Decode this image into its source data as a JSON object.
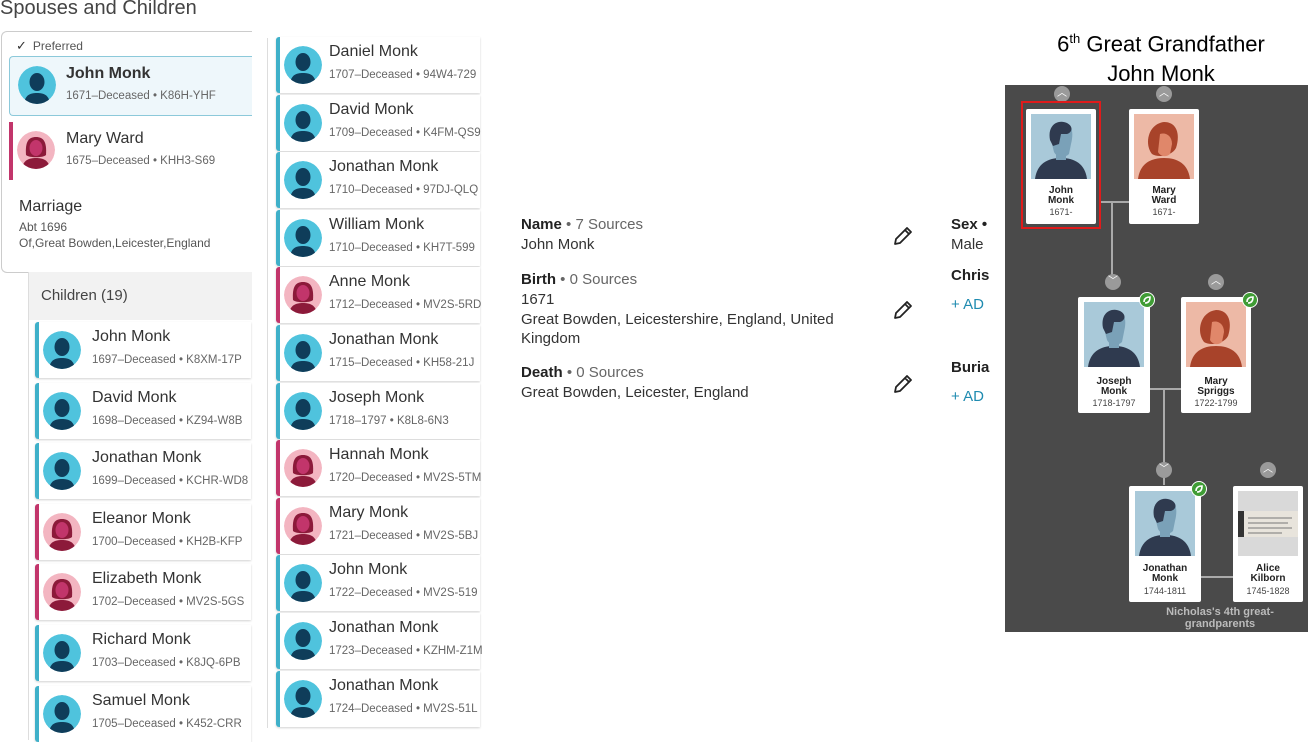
{
  "spouses": {
    "title": "Spouses and Children",
    "preferred_label": "Preferred",
    "husband": {
      "name": "John Monk",
      "meta": "1671–Deceased • K86H-YHF"
    },
    "wife": {
      "name": "Mary Ward",
      "meta": "1675–Deceased • KHH3-S69"
    },
    "marriage": {
      "title": "Marriage",
      "date": "Abt 1696",
      "place": "Of,Great Bowden,Leicester,England"
    }
  },
  "children_header": "Children (19)",
  "children_col1": [
    {
      "name": "John Monk",
      "meta": "1697–Deceased • K8XM-17P",
      "gender": "male"
    },
    {
      "name": "David Monk",
      "meta": "1698–Deceased • KZ94-W8B",
      "gender": "male"
    },
    {
      "name": "Jonathan Monk",
      "meta": "1699–Deceased • KCHR-WD8",
      "gender": "male"
    },
    {
      "name": "Eleanor Monk",
      "meta": "1700–Deceased • KH2B-KFP",
      "gender": "female"
    },
    {
      "name": "Elizabeth Monk",
      "meta": "1702–Deceased • MV2S-5GS",
      "gender": "female"
    },
    {
      "name": "Richard Monk",
      "meta": "1703–Deceased • K8JQ-6PB",
      "gender": "male"
    },
    {
      "name": "Samuel Monk",
      "meta": "1705–Deceased • K452-CRR",
      "gender": "male"
    }
  ],
  "children_col2": [
    {
      "name": "Daniel Monk",
      "meta": "1707–Deceased • 94W4-729",
      "gender": "male"
    },
    {
      "name": "David Monk",
      "meta": "1709–Deceased • K4FM-QS9",
      "gender": "male"
    },
    {
      "name": "Jonathan Monk",
      "meta": "1710–Deceased • 97DJ-QLQ",
      "gender": "male"
    },
    {
      "name": "William Monk",
      "meta": "1710–Deceased • KH7T-599",
      "gender": "male"
    },
    {
      "name": "Anne Monk",
      "meta": "1712–Deceased • MV2S-5RD",
      "gender": "female"
    },
    {
      "name": "Jonathan Monk",
      "meta": "1715–Deceased • KH58-21J",
      "gender": "male"
    },
    {
      "name": "Joseph Monk",
      "meta": "1718–1797 • K8L8-6N3",
      "gender": "male"
    },
    {
      "name": "Hannah Monk",
      "meta": "1720–Deceased • MV2S-5TM",
      "gender": "female"
    },
    {
      "name": "Mary Monk",
      "meta": "1721–Deceased • MV2S-5BJ",
      "gender": "female"
    },
    {
      "name": "John Monk",
      "meta": "1722–Deceased • MV2S-519",
      "gender": "male"
    },
    {
      "name": "Jonathan Monk",
      "meta": "1723–Deceased • KZHM-Z1M",
      "gender": "male"
    },
    {
      "name": "Jonathan Monk",
      "meta": "1724–Deceased • MV2S-51L",
      "gender": "male"
    }
  ],
  "details": {
    "name": {
      "label": "Name",
      "sources": " • 7 Sources",
      "value": "John Monk"
    },
    "birth": {
      "label": "Birth",
      "sources": " • 0 Sources",
      "date": "1671",
      "place_line1": "Great Bowden, Leicestershire, England, United",
      "place_line2": "Kingdom"
    },
    "death": {
      "label": "Death",
      "sources": " • 0 Sources",
      "place": "Great Bowden, Leicester, England"
    },
    "sex_label": "Sex •",
    "sex_value": "Male",
    "christening_label": "Chris",
    "burial_label": "Buria",
    "add_label": "+ AD"
  },
  "tree": {
    "title_ordinal": "6",
    "title_suffix": "th",
    "title_rest": " Great Grandfather",
    "title_name": "John Monk",
    "people": {
      "john": {
        "name1": "John",
        "name2": "Monk",
        "dates": "1671-"
      },
      "mary_ward": {
        "name1": "Mary",
        "name2": "Ward",
        "dates": "1671-"
      },
      "joseph": {
        "name1": "Joseph",
        "name2": "Monk",
        "dates": "1718-1797"
      },
      "mary_spriggs": {
        "name1": "Mary",
        "name2": "Spriggs",
        "dates": "1722-1799"
      },
      "jonathan": {
        "name1": "Jonathan",
        "name2": "Monk",
        "dates": "1744-1811"
      },
      "alice": {
        "name1": "Alice",
        "name2": "Kilborn",
        "dates": "1745-1828"
      }
    },
    "caption_line1": "Nicholas's 4th great-",
    "caption_line2": "grandparents",
    "highlight_color": "#e01b1b"
  },
  "colors": {
    "male_bar": "#3fb0c9",
    "female_bar": "#c2356b",
    "link": "#1f8bb0",
    "tree_bg": "#4a4a4a"
  }
}
